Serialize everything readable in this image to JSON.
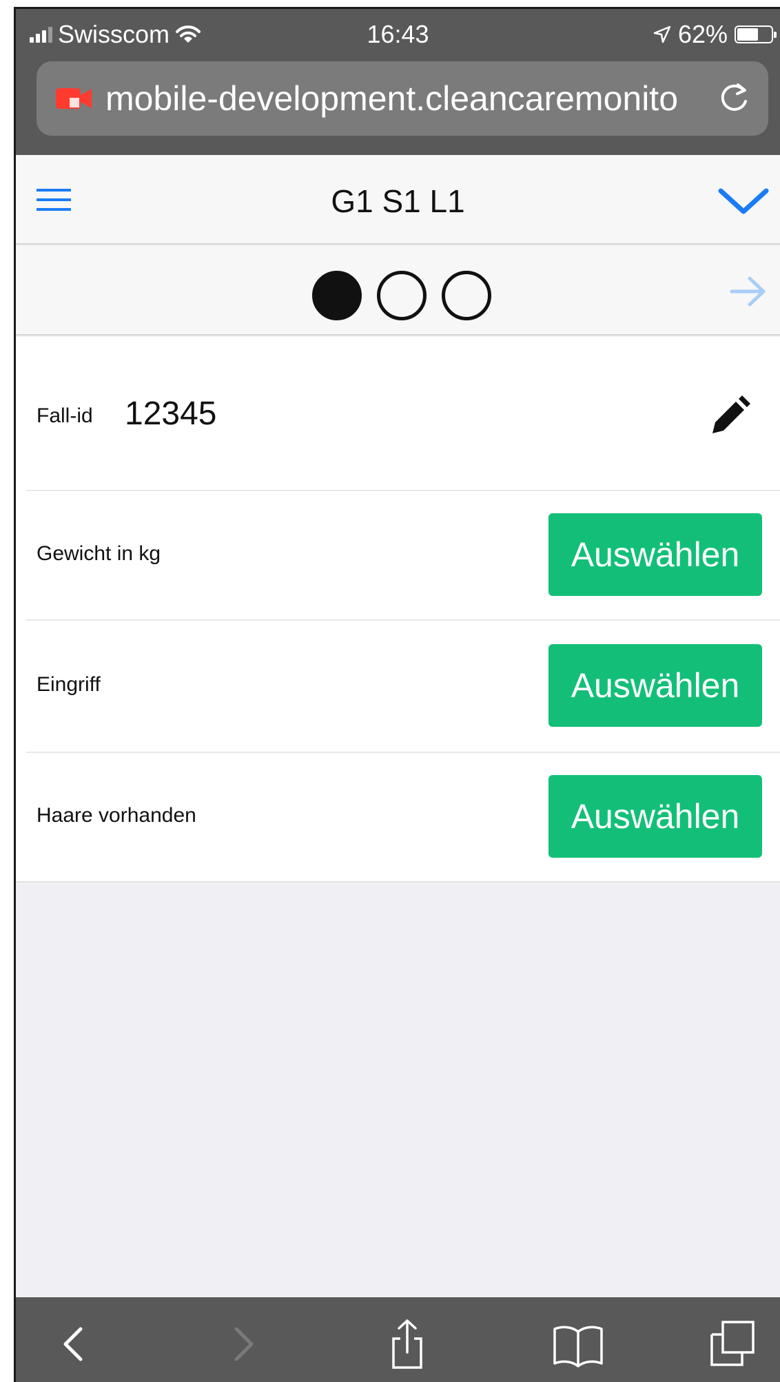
{
  "status_bar": {
    "carrier": "Swisscom",
    "time": "16:43",
    "battery_percent_label": "62%",
    "battery_level": 0.62
  },
  "browser": {
    "url": "mobile-development.cleancaremonito",
    "icons": [
      "camera-icon",
      "reload-icon"
    ]
  },
  "header": {
    "title": "G1 S1 L1",
    "icons": [
      "hamburger-menu-icon",
      "chevron-down-icon"
    ]
  },
  "steps": {
    "total": 3,
    "current": 1,
    "next_icon": "arrow-right-icon"
  },
  "form": {
    "case_id_label": "Fall-id",
    "case_id_value": "12345",
    "fields": [
      {
        "label": "Gewicht in kg",
        "button": "Auswählen"
      },
      {
        "label": "Eingriff",
        "button": "Auswählen"
      },
      {
        "label": "Haare vorhanden",
        "button": "Auswählen"
      }
    ]
  },
  "colors": {
    "accent_blue": "#1a7cf5",
    "button_green": "#13bf78",
    "browser_chrome": "#595959"
  },
  "toolbar": {
    "icons": [
      "back-icon",
      "forward-icon",
      "share-icon",
      "bookmarks-icon",
      "tabs-icon"
    ]
  }
}
